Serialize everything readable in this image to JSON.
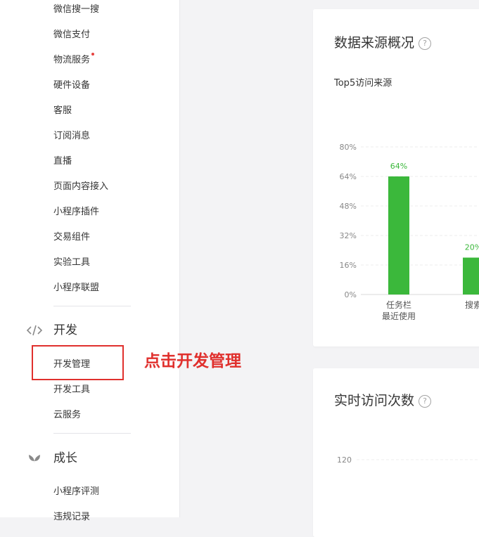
{
  "sidebar": {
    "items_top": [
      {
        "label": "微信搜一搜"
      },
      {
        "label": "微信支付"
      },
      {
        "label": "物流服务",
        "dot": true
      },
      {
        "label": "硬件设备"
      },
      {
        "label": "客服"
      },
      {
        "label": "订阅消息"
      },
      {
        "label": "直播"
      },
      {
        "label": "页面内容接入"
      },
      {
        "label": "小程序插件"
      },
      {
        "label": "交易组件"
      },
      {
        "label": "实验工具"
      },
      {
        "label": "小程序联盟"
      }
    ],
    "dev_section": {
      "title": "开发",
      "icon": "code-icon",
      "items": [
        {
          "label": "开发管理"
        },
        {
          "label": "开发工具"
        },
        {
          "label": "云服务"
        }
      ]
    },
    "growth_section": {
      "title": "成长",
      "icon": "sprout-icon",
      "items": [
        {
          "label": "小程序评测"
        },
        {
          "label": "违规记录"
        }
      ]
    }
  },
  "annotation": {
    "text": "点击开发管理",
    "color": "#e0302d"
  },
  "cards": {
    "source_overview": {
      "title": "数据来源概况",
      "help": "?",
      "subtitle": "Top5访问来源"
    },
    "realtime_visits": {
      "title": "实时访问次数",
      "help": "?"
    }
  },
  "chart_data": [
    {
      "type": "bar",
      "categories": [
        "任务栏\n最近使用",
        "搜索"
      ],
      "category_labels_visible": [
        "任务栏 最近使用",
        "搜索"
      ],
      "values": [
        64,
        20
      ],
      "value_labels": [
        "64%",
        "20%"
      ],
      "yticks": [
        "0%",
        "16%",
        "32%",
        "48%",
        "64%",
        "80%"
      ],
      "ylim": [
        0,
        80
      ],
      "bar_color": "#3bb83b",
      "grid": true
    },
    {
      "type": "line",
      "yticks": [
        "120"
      ],
      "grid": true
    }
  ]
}
